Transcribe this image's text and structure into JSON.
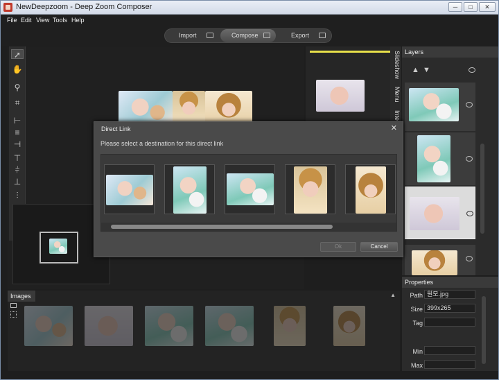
{
  "window": {
    "title": "NewDeepzoom - Deep Zoom Composer",
    "min": "─",
    "max": "□",
    "close": "✕"
  },
  "menu": {
    "items": [
      "File",
      "Edit",
      "View",
      "Tools",
      "Help"
    ]
  },
  "modes": {
    "import": "Import",
    "compose": "Compose",
    "export": "Export"
  },
  "right_tabs": [
    "Slideshow",
    "Menu",
    "Inte"
  ],
  "layers": {
    "title": "Layers",
    "up": "▲",
    "down": "▼"
  },
  "properties": {
    "title": "Properties",
    "fields": [
      {
        "label": "Path",
        "value": "원모.jpg"
      },
      {
        "label": "Size",
        "value": "399x265"
      },
      {
        "label": "Tag",
        "value": ""
      },
      {
        "label": "Min",
        "value": ""
      },
      {
        "label": "Max",
        "value": ""
      }
    ]
  },
  "images": {
    "title": "Images",
    "collapse": "▲"
  },
  "dialog": {
    "title": "Direct Link",
    "close": "✕",
    "prompt": "Please select a destination for this direct link",
    "ok": "Ok",
    "cancel": "Cancel"
  },
  "colors": {
    "accent": "#e8e04a",
    "background": "#1e1e1e",
    "panel": "#2b2b2b"
  }
}
